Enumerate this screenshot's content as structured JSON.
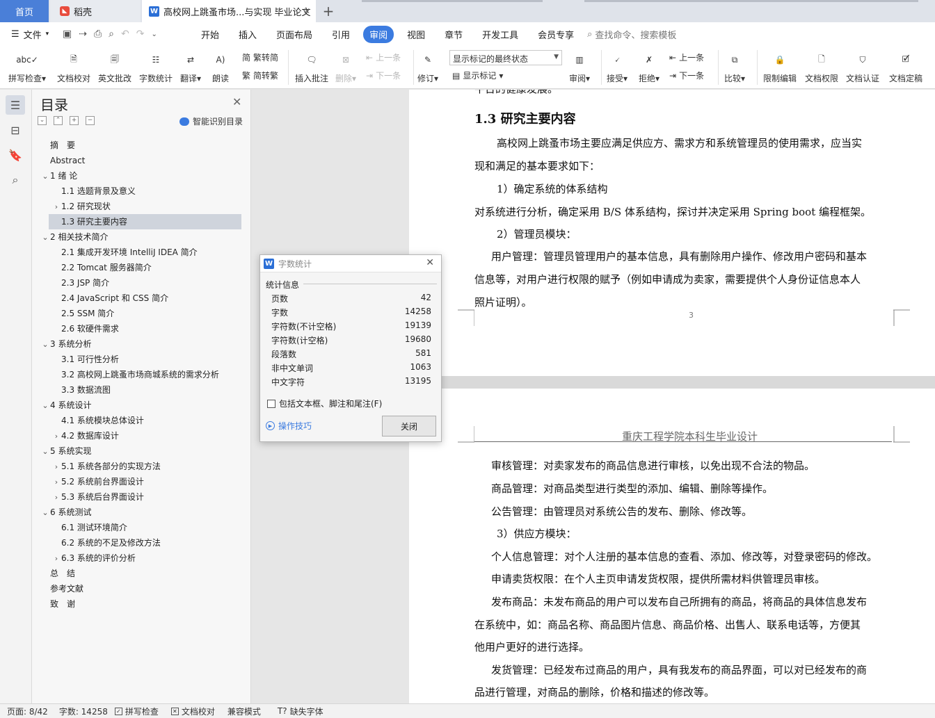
{
  "tabs": {
    "home": "首页",
    "daoke": "稻壳",
    "doc": "高校网上跳蚤市场...与实现 毕业论文",
    "add": "+"
  },
  "menu": {
    "file": "文件",
    "items": [
      "开始",
      "插入",
      "页面布局",
      "引用",
      "审阅",
      "视图",
      "章节",
      "开发工具",
      "会员专享"
    ],
    "active": "审阅",
    "search": "查找命令、搜索模板"
  },
  "ribbon": {
    "spellcheck": "拼写检查",
    "doc_proof": "文档校对",
    "english_grading": "英文批改",
    "word_count": "字数统计",
    "translate": "翻译",
    "read_aloud": "朗读",
    "trad_to_simp": "繁转简",
    "simp_to_trad": "简转繁",
    "insert_comment": "插入批注",
    "delete": "删除",
    "prev": "上一条",
    "next": "下一条",
    "track_changes": "修订",
    "markup_state": "显示标记的最终状态",
    "show_markup": "显示标记",
    "review": "审阅",
    "accept": "接受",
    "reject": "拒绝",
    "prev2": "上一条",
    "next2": "下一条",
    "compare": "比较",
    "restrict_editing": "限制编辑",
    "doc_permission": "文档权限",
    "doc_certify": "文档认证",
    "doc_finalize": "文档定稿"
  },
  "toc": {
    "title": "目录",
    "smart": "智能识别目录",
    "items": [
      {
        "label": "摘　要",
        "level": 0,
        "arrow": ""
      },
      {
        "label": "Abstract",
        "level": 0,
        "arrow": ""
      },
      {
        "label": "1 绪 论",
        "level": 0,
        "arrow": "v"
      },
      {
        "label": "1.1 选题背景及意义",
        "level": 1,
        "arrow": ""
      },
      {
        "label": "1.2 研究现状",
        "level": 1,
        "arrow": ">"
      },
      {
        "label": "1.3 研究主要内容",
        "level": 1,
        "arrow": "",
        "selected": true
      },
      {
        "label": "2 相关技术简介",
        "level": 0,
        "arrow": "v"
      },
      {
        "label": "2.1 集成开发环境 IntelliJ IDEA 简介",
        "level": 1,
        "arrow": ""
      },
      {
        "label": "2.2 Tomcat 服务器简介",
        "level": 1,
        "arrow": ""
      },
      {
        "label": "2.3 JSP 简介",
        "level": 1,
        "arrow": ""
      },
      {
        "label": "2.4 JavaScript 和 CSS 简介",
        "level": 1,
        "arrow": ""
      },
      {
        "label": "2.5 SSM 简介",
        "level": 1,
        "arrow": ""
      },
      {
        "label": "2.6 软硬件需求",
        "level": 1,
        "arrow": ""
      },
      {
        "label": "3 系统分析",
        "level": 0,
        "arrow": "v"
      },
      {
        "label": "3.1 可行性分析",
        "level": 1,
        "arrow": ""
      },
      {
        "label": "3.2 高校网上跳蚤市场商城系统的需求分析",
        "level": 1,
        "arrow": ""
      },
      {
        "label": "3.3 数据流图",
        "level": 1,
        "arrow": ""
      },
      {
        "label": "4 系统设计",
        "level": 0,
        "arrow": "v"
      },
      {
        "label": "4.1 系统模块总体设计",
        "level": 1,
        "arrow": ""
      },
      {
        "label": "4.2 数据库设计",
        "level": 1,
        "arrow": ">"
      },
      {
        "label": "5 系统实现",
        "level": 0,
        "arrow": "v"
      },
      {
        "label": "5.1 系统各部分的实现方法",
        "level": 1,
        "arrow": ">"
      },
      {
        "label": "5.2 系统前台界面设计",
        "level": 1,
        "arrow": ">"
      },
      {
        "label": "5.3 系统后台界面设计",
        "level": 1,
        "arrow": ">"
      },
      {
        "label": "6 系统测试",
        "level": 0,
        "arrow": "v"
      },
      {
        "label": "6.1 测试环境简介",
        "level": 1,
        "arrow": ""
      },
      {
        "label": "6.2 系统的不足及修改方法",
        "level": 1,
        "arrow": ""
      },
      {
        "label": "6.3 系统的评价分析",
        "level": 1,
        "arrow": ">"
      },
      {
        "label": "总　结",
        "level": 0,
        "arrow": ""
      },
      {
        "label": "参考文献",
        "level": 0,
        "arrow": ""
      },
      {
        "label": "致　谢",
        "level": 0,
        "arrow": ""
      }
    ]
  },
  "page1": {
    "cut_top": "平台的健康发展。",
    "heading": "1.3 研究主要内容",
    "p1": "高校网上跳蚤市场主要应满足供应方、需求方和系统管理员的使用需求，应当实",
    "p2": "现和满足的基本要求如下：",
    "p3": "1）确定系统的体系结构",
    "p4": "对系统进行分析，确定采用 B/S 体系结构，探讨并决定采用 Spring boot 编程框架。",
    "p5": "2）管理员模块：",
    "p6": "用户管理：管理员管理用户的基本信息，具有删除用户操作、修改用户密码和基本",
    "p7": "信息等，对用户进行权限的赋予（例如申请成为卖家，需要提供个人身份证信息本人",
    "p8": "照片证明）。",
    "page_number": "3"
  },
  "page2": {
    "header": "重庆工程学院本科生毕业设计",
    "lines": [
      "审核管理：对卖家发布的商品信息进行审核，以免出现不合法的物品。",
      "商品管理：对商品类型进行类型的添加、编辑、删除等操作。",
      "公告管理：由管理员对系统公告的发布、删除、修改等。",
      "3）供应方模块：",
      "个人信息管理：对个人注册的基本信息的查看、添加、修改等，对登录密码的修改。",
      "申请卖货权限：在个人主页申请发货权限，提供所需材料供管理员审核。",
      "发布商品：未发布商品的用户可以发布自己所拥有的商品，将商品的具体信息发布",
      "在系统中，如：商品名称、商品图片信息、商品价格、出售人、联系电话等，方便其",
      "他用户更好的进行选择。",
      "发货管理：已经发布过商品的用户，具有我发布的商品界面，可以对已经发布的商",
      "品进行管理，对商品的删除，价格和描述的修改等。"
    ]
  },
  "dialog": {
    "title": "字数统计",
    "section": "统计信息",
    "stats": [
      {
        "label": "页数",
        "value": "42"
      },
      {
        "label": "字数",
        "value": "14258"
      },
      {
        "label": "字符数(不计空格)",
        "value": "19139"
      },
      {
        "label": "字符数(计空格)",
        "value": "19680"
      },
      {
        "label": "段落数",
        "value": "581"
      },
      {
        "label": "非中文单词",
        "value": "1063"
      },
      {
        "label": "中文字符",
        "value": "13195"
      }
    ],
    "include_label": "包括文本框、脚注和尾注(F)",
    "tips": "操作技巧",
    "close_button": "关闭"
  },
  "status": {
    "page": "页面: 8/42",
    "words": "字数: 14258",
    "spellcheck": "拼写检查",
    "proof": "文档校对",
    "compat": "兼容模式",
    "missing_font": "缺失字体"
  }
}
